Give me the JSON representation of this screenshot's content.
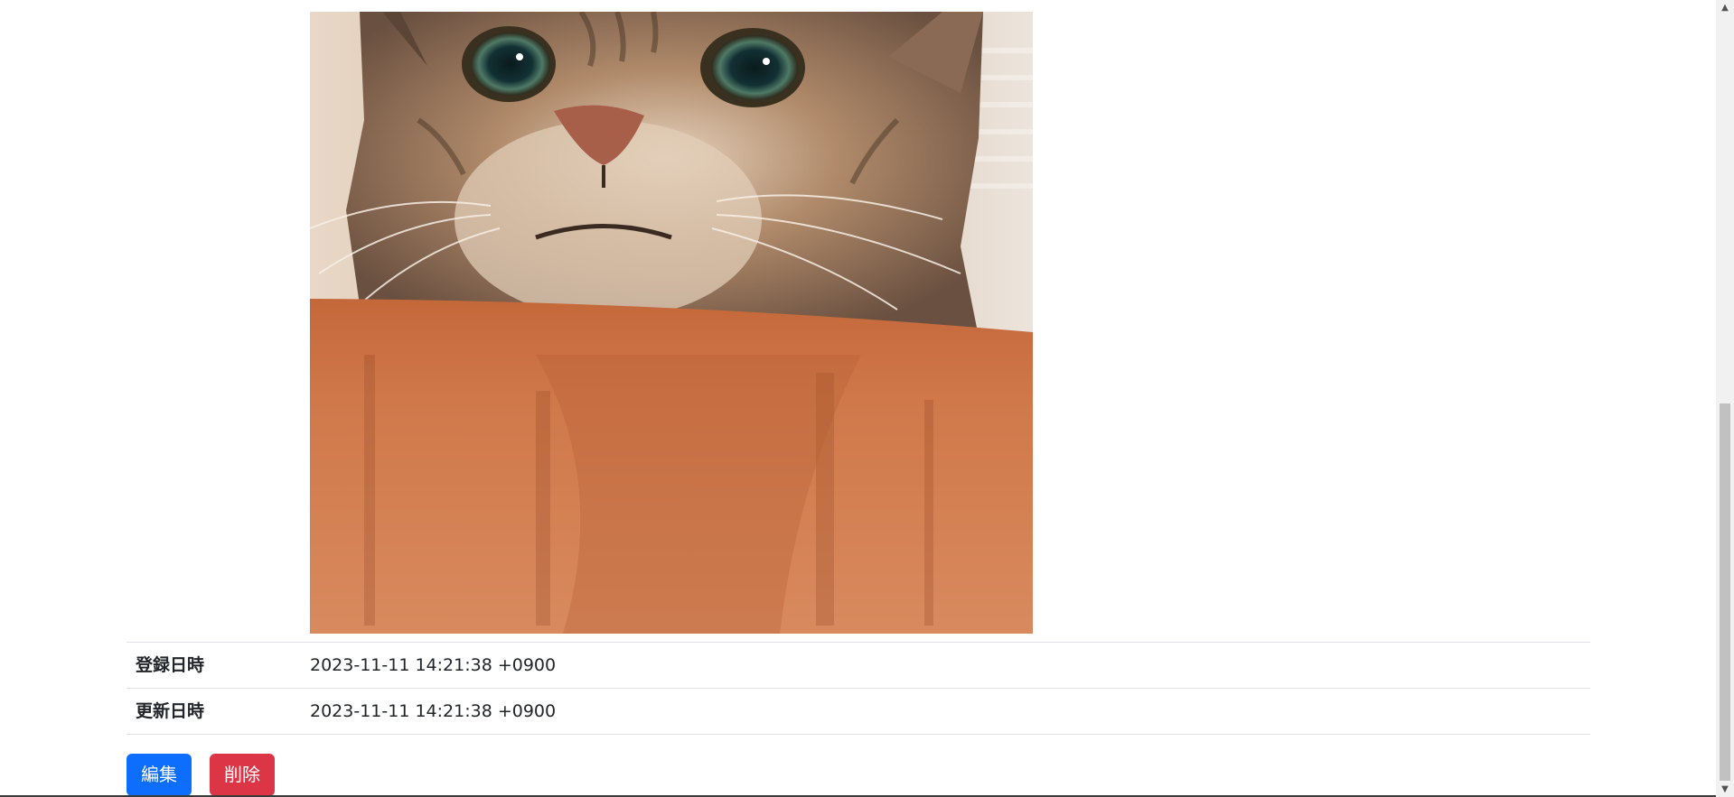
{
  "photo": {
    "subject": "tabby cat peeking over wooden table"
  },
  "details": {
    "rows": [
      {
        "label": "登録日時",
        "value": "2023-11-11 14:21:38 +0900"
      },
      {
        "label": "更新日時",
        "value": "2023-11-11 14:21:38 +0900"
      }
    ]
  },
  "actions": {
    "edit_label": "編集",
    "delete_label": "削除"
  },
  "colors": {
    "primary": "#0d6efd",
    "danger": "#dc3545",
    "border": "#dee2e6"
  },
  "scrollbar": {
    "up_icon": "triangle-up-icon",
    "down_icon": "triangle-down-icon"
  }
}
